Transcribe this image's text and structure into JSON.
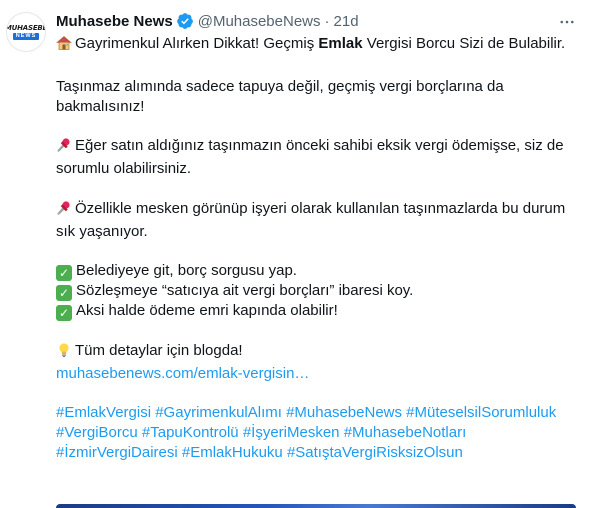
{
  "tweet": {
    "author": {
      "display_name": "Muhasebe News",
      "handle": "@MuhasebeNews",
      "separator": "·",
      "timestamp": "21d",
      "verified": true,
      "avatar_logo_top": "MUHASEBE",
      "avatar_logo_bottom": "NEWS",
      "avatar_icon": "muhasebe-news-logo"
    },
    "more_icon": "ellipsis-icon",
    "content": {
      "title_prefix": "Gayrimenkul Alırken Dikkat! Geçmiş ",
      "title_bold": "Emlak",
      "title_suffix": " Vergisi Borcu Sizi de Bulabilir.",
      "intro": "Taşınmaz alımında sadece tapuya değil, geçmiş vergi borçlarına da bakmalısınız!",
      "point1": "Eğer satın aldığınız taşınmazın önceki sahibi eksik vergi ödemişse, siz de sorumlu olabilirsiniz.",
      "point2": "Özellikle mesken görünüp işyeri olarak kullanılan taşınmazlarda bu durum sık yaşanıyor.",
      "checklist": [
        "Belediyeye git, borç sorgusu yap.",
        "Sözleşmeye “satıcıya ait vergi borçları” ibaresi koy.",
        "Aksi halde ödeme emri kapında olabilir!"
      ],
      "details_text": "Tüm detaylar için blogda!",
      "link": "muhasebenews.com/emlak-vergisin…",
      "hashtags": [
        "#EmlakVergisi",
        "#GayrimenkulAlımı",
        "#MuhasebeNews",
        "#MüteselsilSorumluluk",
        "#VergiBorcu",
        "#TapuKontrolü",
        "#İşyeriMesken",
        "#MuhasebeNotları",
        "#İzmirVergiDairesi",
        "#EmlakHukuku",
        "#SatıştaVergiRisksizOlsun"
      ],
      "emoji_icons": {
        "title": "house-icon",
        "points": "pushpin-icon",
        "checklist": "check-mark-icon",
        "details": "light-bulb-icon"
      }
    },
    "colors": {
      "link": "#1d9bf0",
      "text": "#0f1419",
      "secondary": "#536471",
      "verified": "#1d9bf0",
      "check": "#4cae4f",
      "pin": "#e0245e"
    }
  }
}
